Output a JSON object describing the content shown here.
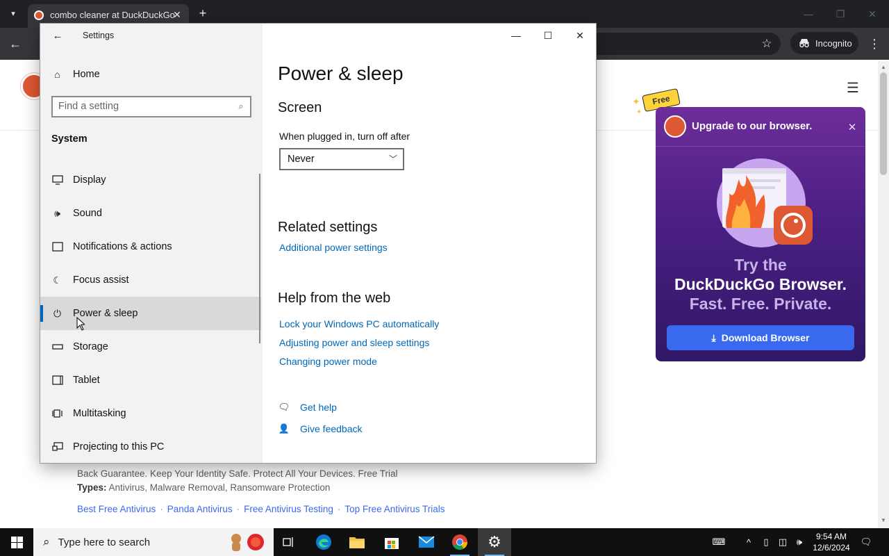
{
  "browser": {
    "tab_title": "combo cleaner at DuckDuckGo",
    "tab_close": "✕",
    "new_tab": "+",
    "incognito_label": "Incognito"
  },
  "ddg_page": {
    "snippet_line": "Back Guarantee. Keep Your Identity Safe. Protect All Your Devices. Free Trial",
    "types_label": "Types:",
    "types_value": "Antivirus, Malware Removal, Ransomware Protection",
    "sitelinks": [
      "Best Free Antivirus",
      "Panda Antivirus",
      "Free Antivirus Testing",
      "Top Free Antivirus Trials"
    ],
    "sitelink_separator": "·"
  },
  "promo": {
    "free_tag": "Free",
    "title": "Upgrade to our browser.",
    "line1": "Try the",
    "line2": "DuckDuckGo Browser.",
    "line3": "Fast. Free. Private.",
    "button_label": "Download Browser",
    "accent": "#3969ef"
  },
  "settings": {
    "window_title": "Settings",
    "home_label": "Home",
    "search_placeholder": "Find a setting",
    "section_label": "System",
    "nav_items": [
      {
        "label": "Display",
        "icon": "monitor-icon"
      },
      {
        "label": "Sound",
        "icon": "speaker-icon"
      },
      {
        "label": "Notifications & actions",
        "icon": "notification-icon"
      },
      {
        "label": "Focus assist",
        "icon": "moon-icon"
      },
      {
        "label": "Power & sleep",
        "icon": "power-icon",
        "active": true
      },
      {
        "label": "Storage",
        "icon": "storage-icon"
      },
      {
        "label": "Tablet",
        "icon": "tablet-icon"
      },
      {
        "label": "Multitasking",
        "icon": "multitasking-icon"
      },
      {
        "label": "Projecting to this PC",
        "icon": "projecting-icon"
      }
    ],
    "page_title": "Power & sleep",
    "screen_heading": "Screen",
    "plugged_in_label": "When plugged in, turn off after",
    "plugged_in_value": "Never",
    "related_heading": "Related settings",
    "related_links": [
      "Additional power settings"
    ],
    "help_heading": "Help from the web",
    "help_links": [
      "Lock your Windows PC automatically",
      "Adjusting power and sleep settings",
      "Changing power mode"
    ],
    "get_help": "Get help",
    "give_feedback": "Give feedback",
    "accent": "#0067c0",
    "link_color": "#0067b8"
  },
  "taskbar": {
    "search_placeholder": "Type here to search",
    "time": "9:54 AM",
    "date": "12/6/2024"
  }
}
